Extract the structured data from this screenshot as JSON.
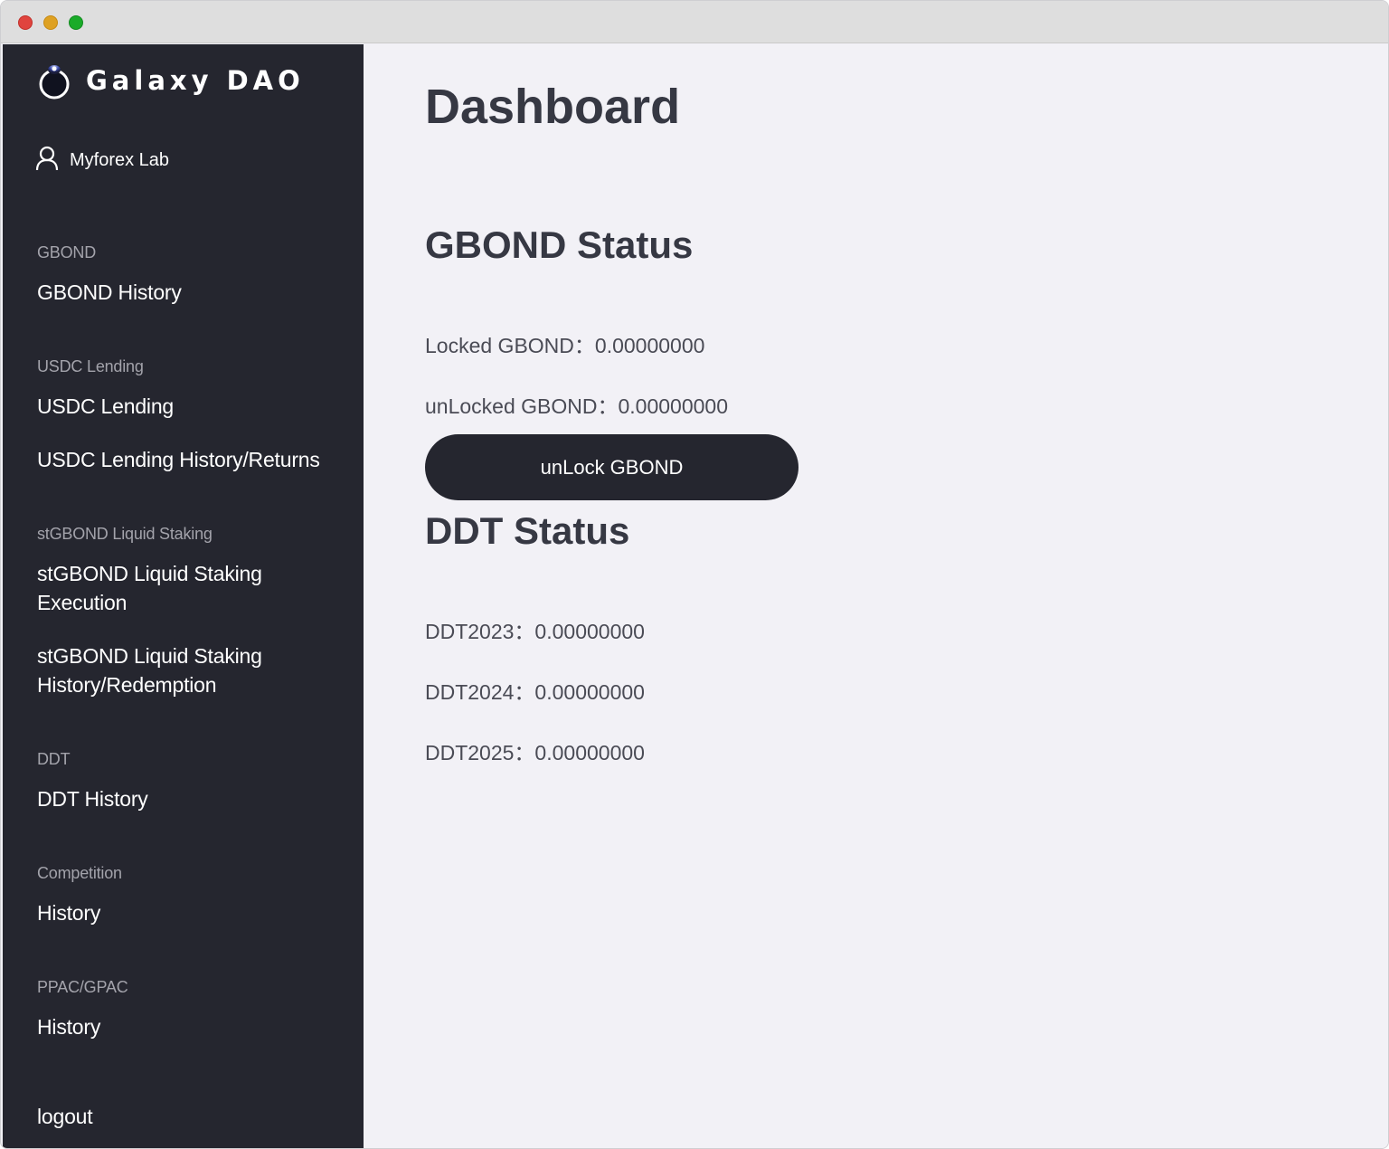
{
  "colors": {
    "sidebar_bg": "#25262f",
    "main_bg": "#f2f1f6",
    "heading_text": "#363843",
    "button_bg": "#25262f"
  },
  "sidebar": {
    "logo": {
      "text": "Galaxy DAO",
      "icon": "moon-orb-icon"
    },
    "user": {
      "icon": "user-icon",
      "label": "Myforex Lab"
    },
    "sections": [
      {
        "heading": "GBOND",
        "items": [
          "GBOND History"
        ]
      },
      {
        "heading": "USDC Lending",
        "items": [
          "USDC Lending",
          "USDC Lending History/Returns"
        ]
      },
      {
        "heading": "stGBOND Liquid Staking",
        "items": [
          "stGBOND Liquid Staking Execution",
          "stGBOND Liquid Staking History/Redemption"
        ]
      },
      {
        "heading": "DDT",
        "items": [
          "DDT History"
        ]
      },
      {
        "heading": "Competition",
        "items": [
          "History"
        ]
      },
      {
        "heading": "PPAC/GPAC",
        "items": [
          "History"
        ]
      }
    ],
    "logout": "logout"
  },
  "main": {
    "title": "Dashboard",
    "gbond": {
      "title": "GBOND Status",
      "locked": "Locked GBOND：0.00000000",
      "unlocked": "unLocked GBOND：0.00000000",
      "button": "unLock GBOND"
    },
    "ddt": {
      "title": "DDT Status",
      "rows": [
        "DDT2023：0.00000000",
        "DDT2024：0.00000000",
        "DDT2025：0.00000000"
      ]
    }
  }
}
